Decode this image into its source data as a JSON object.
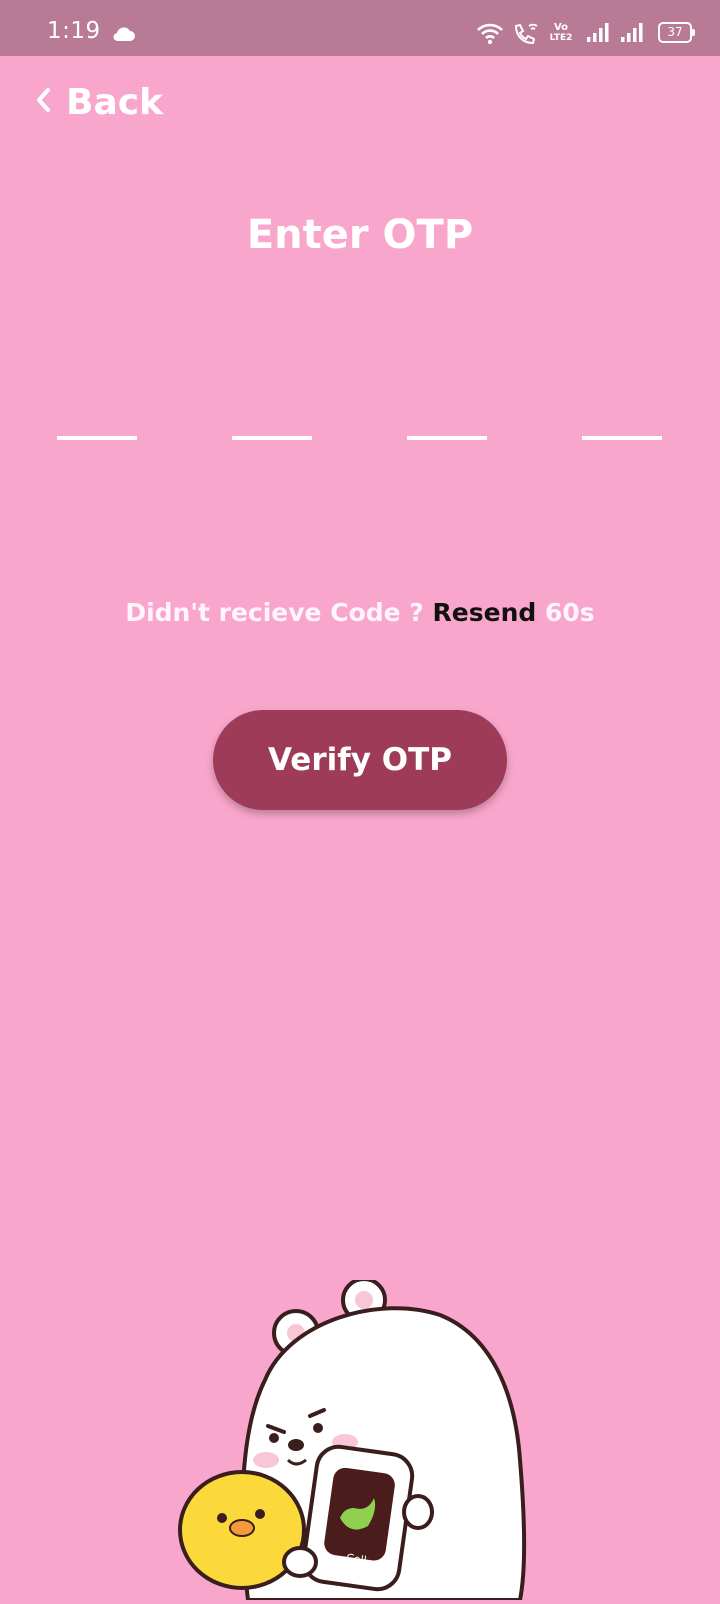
{
  "status_bar": {
    "time": "1:19",
    "battery": "37",
    "lte_label_top": "Vo",
    "lte_label_bottom": "LTE2"
  },
  "header": {
    "back_label": "Back"
  },
  "page": {
    "title": "Enter OTP"
  },
  "otp": {
    "slots": [
      "",
      "",
      "",
      ""
    ]
  },
  "resend": {
    "prompt": "Didn't recieve Code ?",
    "link_label": "Resend",
    "countdown": "60s"
  },
  "actions": {
    "verify_label": "Verify OTP"
  },
  "mascot": {
    "card_text": "Cell"
  },
  "colors": {
    "background": "#f9a6cc",
    "status_bar": "#b97a95",
    "button": "#9e3b58",
    "text": "#ffffff",
    "link": "#111111"
  },
  "icons": [
    "cloud-icon",
    "wifi-icon",
    "wifi-calling-icon",
    "volte-icon",
    "signal-icon",
    "battery-icon",
    "chevron-left-icon"
  ]
}
